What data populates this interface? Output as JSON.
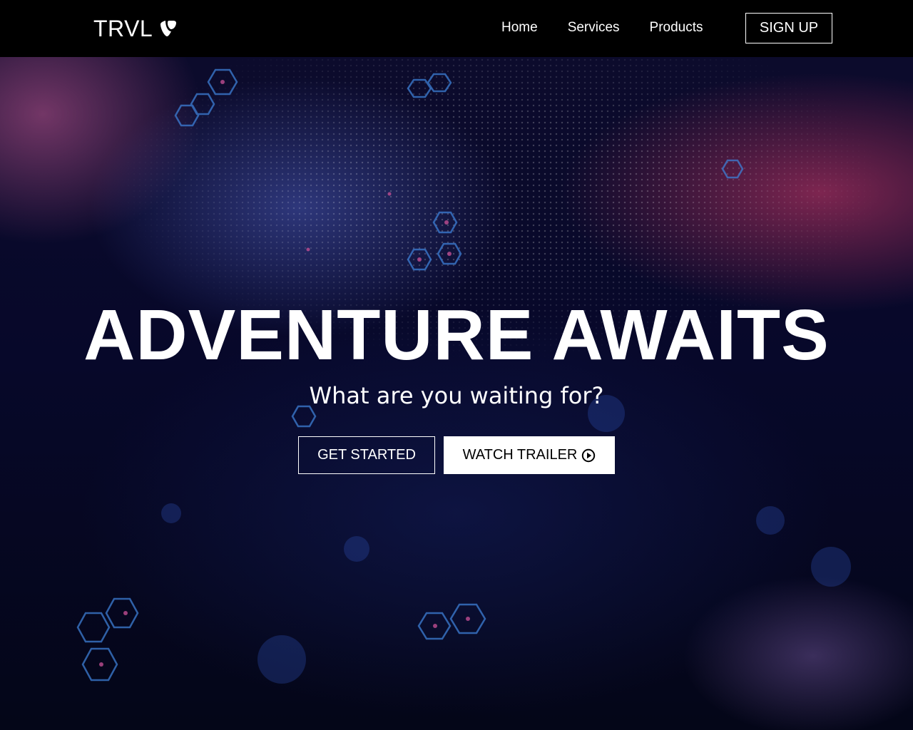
{
  "navbar": {
    "logo_text": "TRVL",
    "logo_icon": "typo3-icon",
    "links": [
      {
        "label": "Home"
      },
      {
        "label": "Services"
      },
      {
        "label": "Products"
      }
    ],
    "signup_label": "SIGN UP"
  },
  "hero": {
    "title": "ADVENTURE AWAITS",
    "subtitle": "What are you waiting for?",
    "primary_button": "GET STARTED",
    "secondary_button": "WATCH TRAILER",
    "secondary_icon": "play-circle-icon"
  },
  "colors": {
    "navbar_bg": "#000000",
    "hero_bg": "#07082a",
    "text": "#ffffff"
  }
}
